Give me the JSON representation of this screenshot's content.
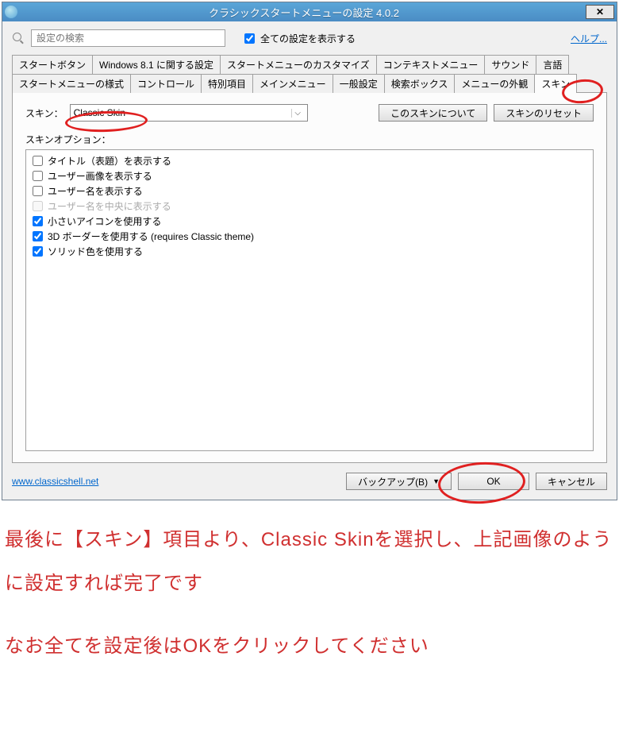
{
  "titlebar": {
    "title": "クラシックスタートメニューの設定 4.0.2",
    "close": "✕"
  },
  "search": {
    "placeholder": "設定の検索"
  },
  "show_all": {
    "label": "全ての設定を表示する",
    "checked": true
  },
  "help_link": "ヘルプ...",
  "tabs_row1": [
    "スタートボタン",
    "Windows 8.1 に関する設定",
    "スタートメニューのカスタマイズ",
    "コンテキストメニュー",
    "サウンド",
    "言語"
  ],
  "tabs_row2": [
    "スタートメニューの様式",
    "コントロール",
    "特別項目",
    "メインメニュー",
    "一般設定",
    "検索ボックス",
    "メニューの外観",
    "スキン"
  ],
  "active_tab": "スキン",
  "skin": {
    "label": "スキン：",
    "value": "Classic Skin",
    "about_btn": "このスキンについて",
    "reset_btn": "スキンのリセット"
  },
  "options_label": "スキンオプション：",
  "options": [
    {
      "label": "タイトル（表題）を表示する",
      "checked": false,
      "disabled": false
    },
    {
      "label": "ユーザー画像を表示する",
      "checked": false,
      "disabled": false
    },
    {
      "label": "ユーザー名を表示する",
      "checked": false,
      "disabled": false
    },
    {
      "label": "ユーザー名を中央に表示する",
      "checked": false,
      "disabled": true
    },
    {
      "label": "小さいアイコンを使用する",
      "checked": true,
      "disabled": false
    },
    {
      "label": "3D ボーダーを使用する (requires Classic theme)",
      "checked": true,
      "disabled": false
    },
    {
      "label": "ソリッド色を使用する",
      "checked": true,
      "disabled": false
    }
  ],
  "footer": {
    "url": "www.classicshell.net",
    "backup": "バックアップ(B)",
    "ok": "OK",
    "cancel": "キャンセル"
  },
  "caption": {
    "line1": "最後に【スキン】項目より、Classic Skinを選択し、上記画像のように設定すれば完了です",
    "line2": "なお全てを設定後はOKをクリックしてください"
  }
}
